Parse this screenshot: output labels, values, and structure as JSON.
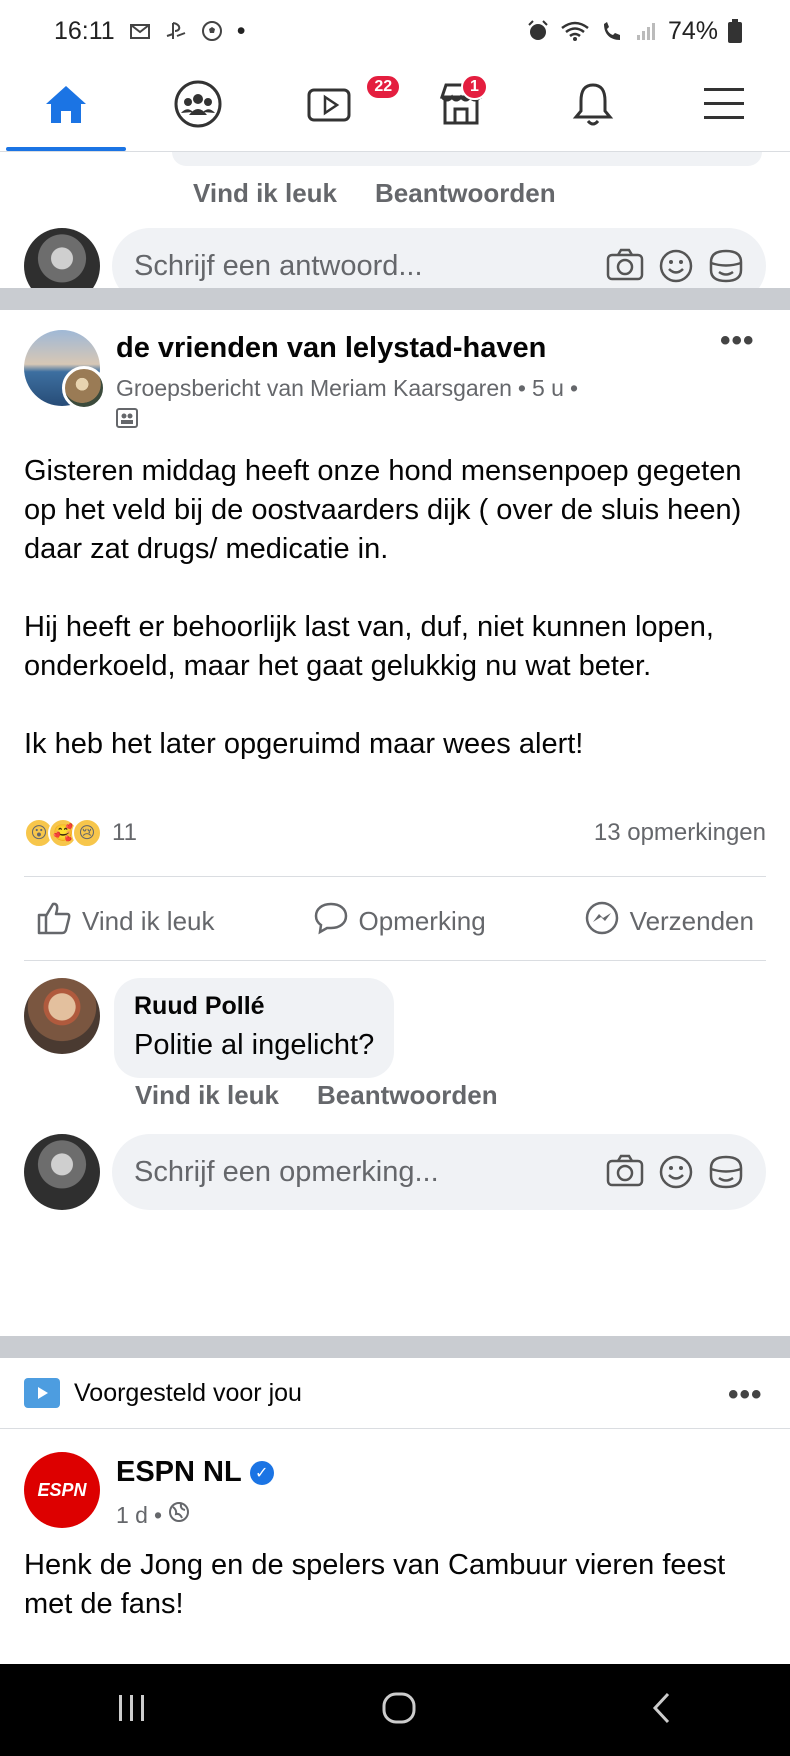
{
  "status_bar": {
    "time": "16:11",
    "left_icons": [
      "gmail-icon",
      "playstation-icon",
      "soccer-icon"
    ],
    "dot": "•",
    "battery": "74%"
  },
  "nav": {
    "items": [
      {
        "name": "home",
        "active": true
      },
      {
        "name": "groups",
        "badge": ""
      },
      {
        "name": "watch",
        "badge": "22"
      },
      {
        "name": "marketplace",
        "badge": "1"
      },
      {
        "name": "notifications",
        "badge": ""
      },
      {
        "name": "menu",
        "badge": ""
      }
    ]
  },
  "previous_comment": {
    "like_label": "Vind ik leuk",
    "reply_label": "Beantwoorden",
    "reply_placeholder": "Schrijf een antwoord..."
  },
  "post": {
    "group_name": "de vrienden van lelystad-haven",
    "meta_prefix": "Groepsbericht van",
    "author": "Meriam Kaarsgaren",
    "time": "5 u",
    "body": [
      "Gisteren middag heeft onze hond mensenpoep gegeten op het veld bij de oostvaarders dijk ( over de sluis heen) daar zat drugs/ medicatie in.",
      "Hij heeft er behoorlijk last van, duf, niet kunnen lopen, onderkoeld, maar het gaat gelukkig nu wat beter.",
      "Ik heb het later opgeruimd maar wees alert!"
    ],
    "reaction_count": "11",
    "comment_count": "13 opmerkingen",
    "actions": {
      "like": "Vind ik leuk",
      "comment": "Opmerking",
      "send": "Verzenden"
    },
    "comment": {
      "name": "Ruud Pollé",
      "text": "Politie al ingelicht?",
      "like": "Vind ik leuk",
      "reply": "Beantwoorden"
    },
    "comment_placeholder": "Schrijf een opmerking..."
  },
  "suggested": {
    "label": "Voorgesteld voor jou",
    "page_name": "ESPN NL",
    "logo_text": "ESPN",
    "time": "1 d",
    "body": "Henk de Jong en de spelers van Cambuur vieren feest met de fans!"
  },
  "colors": {
    "brand": "#1b74e4",
    "badge": "#e41e3f",
    "secondary_text": "#65676b"
  }
}
